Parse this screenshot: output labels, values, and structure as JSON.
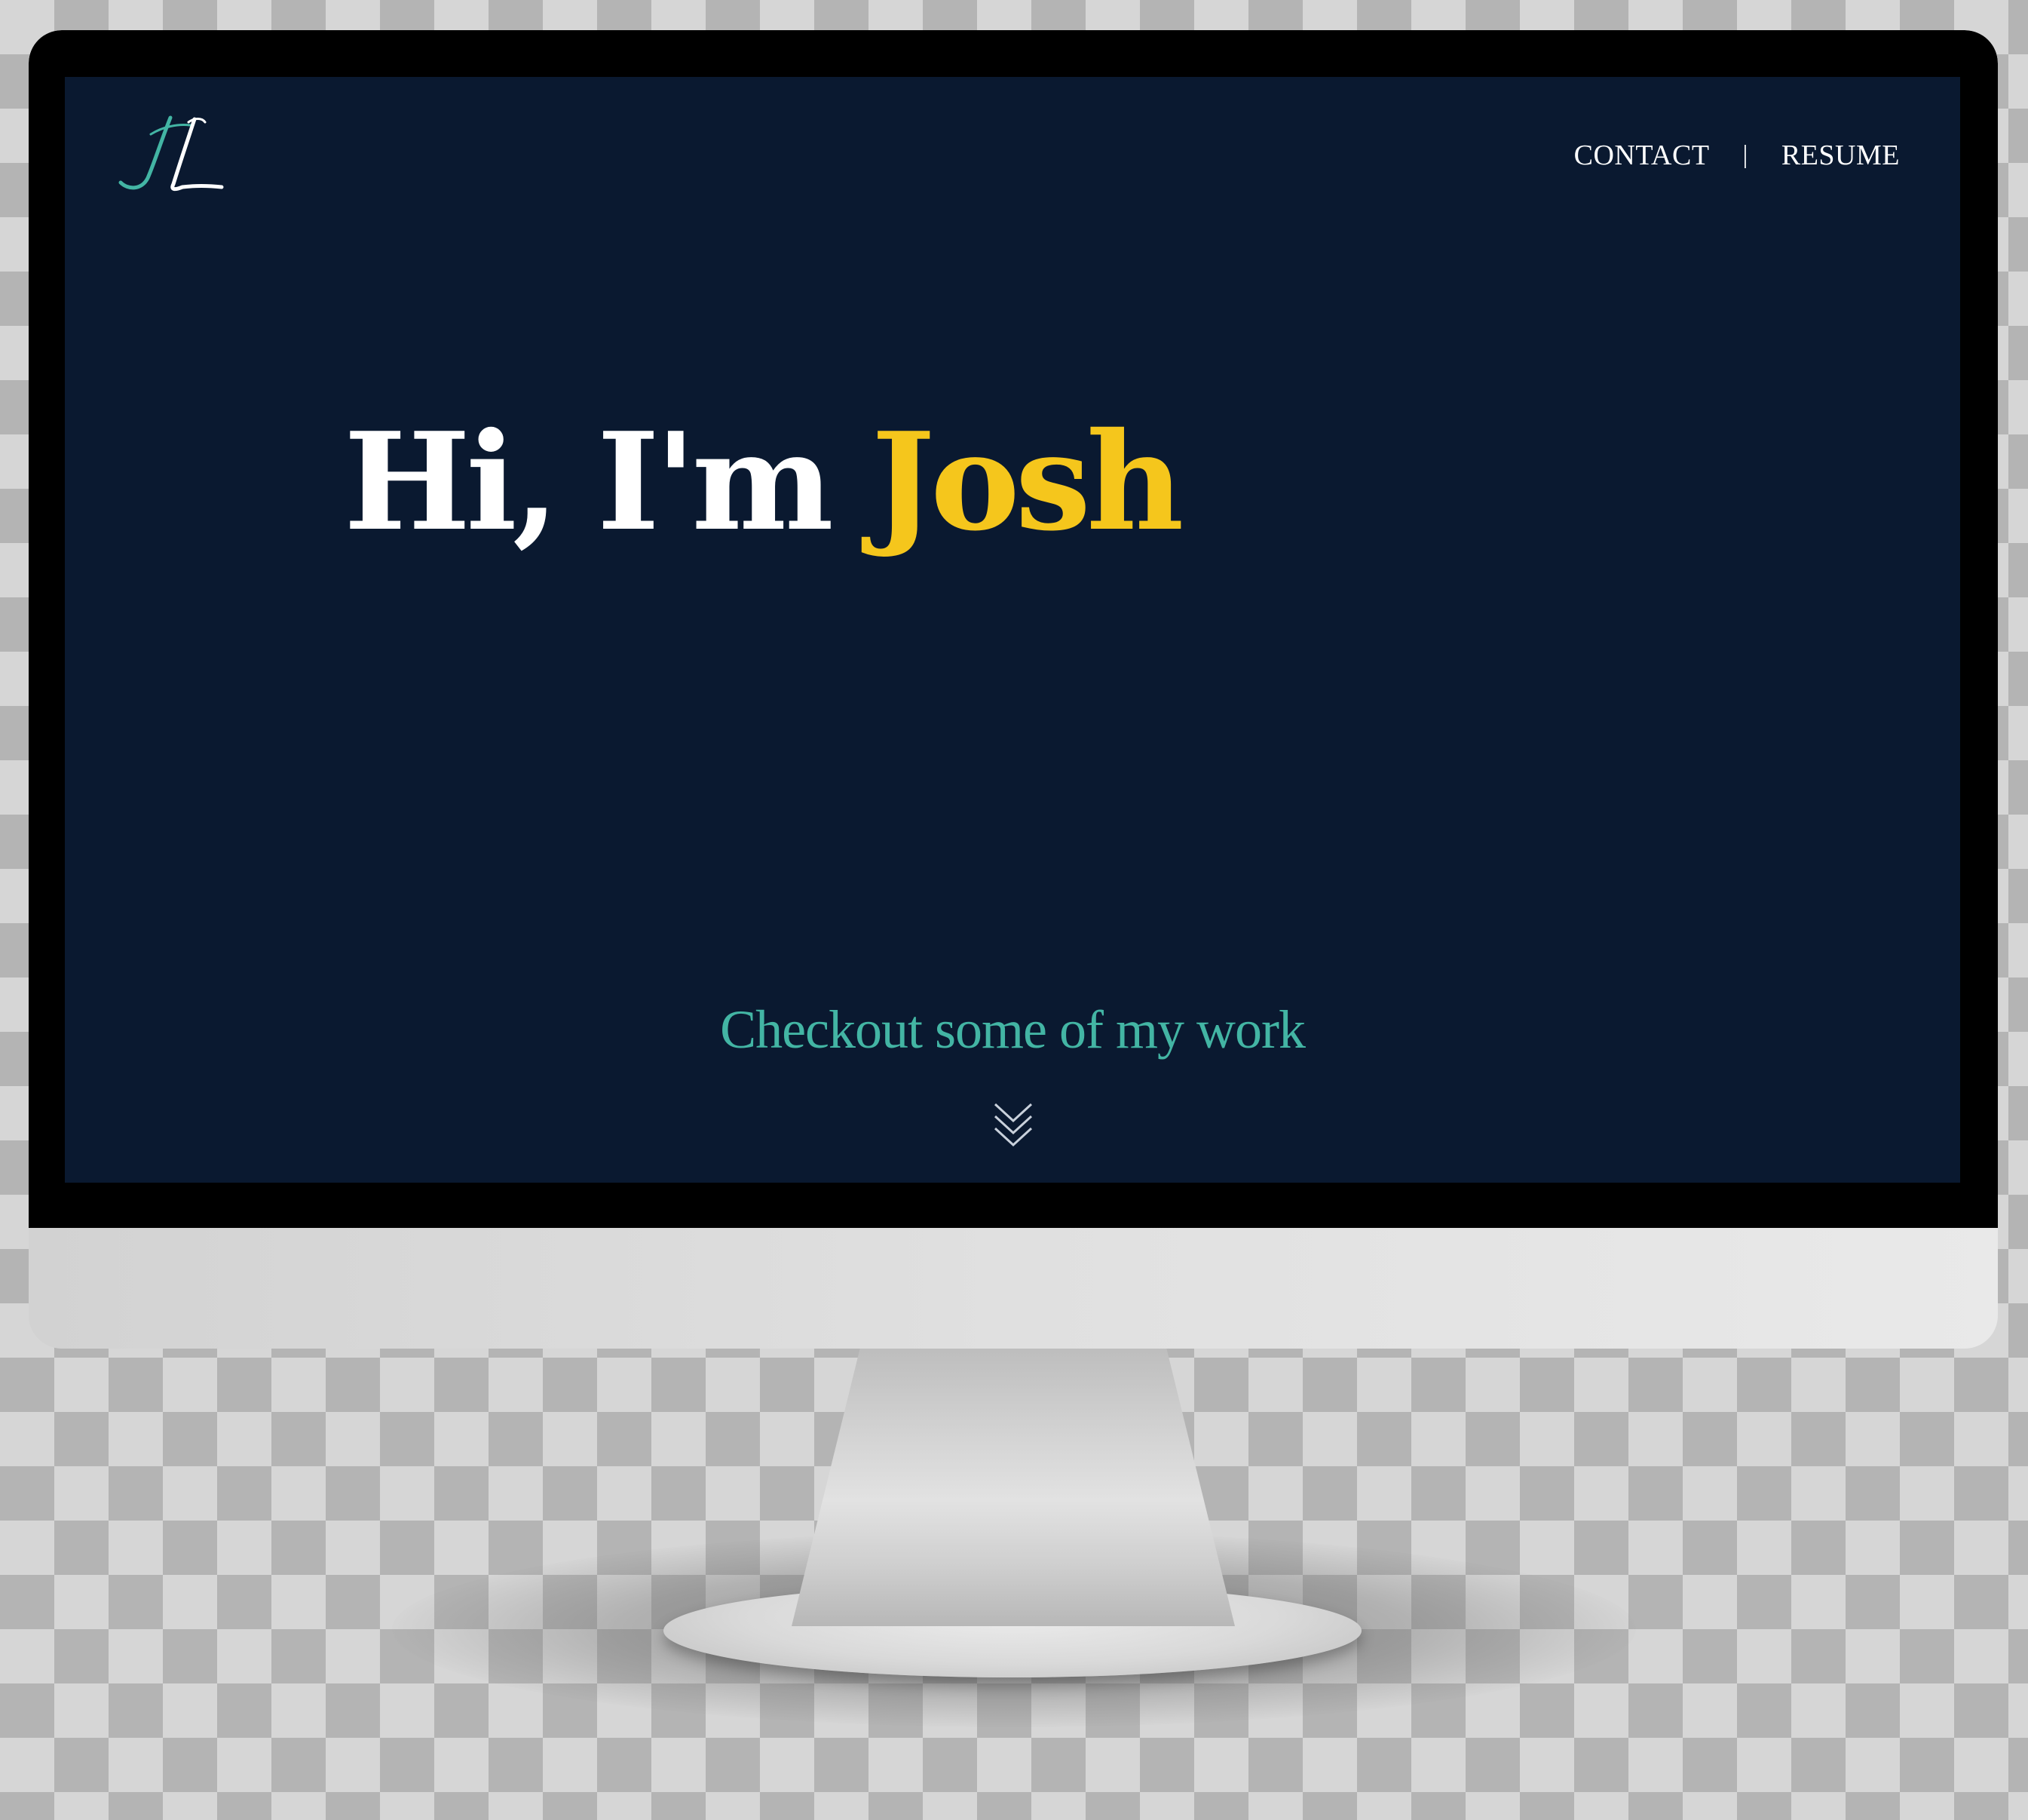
{
  "nav": {
    "contact_label": "CONTACT",
    "separator": "|",
    "resume_label": "RESUME"
  },
  "hero": {
    "greeting": "Hi, I'm",
    "name": "Josh"
  },
  "work_prompt": "Checkout some of my work",
  "icons": {
    "logo": "jl-monogram-logo",
    "scroll": "triple-chevron-down-icon"
  },
  "colors": {
    "background": "#0a1930",
    "accent_yellow": "#f5c61c",
    "accent_teal": "#43b5a4",
    "text": "#ffffff"
  }
}
